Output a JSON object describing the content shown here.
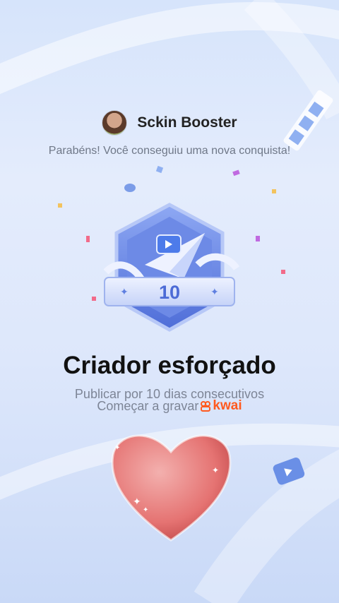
{
  "header": {
    "username": "Sckin Booster"
  },
  "congrats_message": "Parabéns! Você conseguiu uma nova conquista!",
  "badge": {
    "level": "10"
  },
  "achievement": {
    "title": "Criador esforçado",
    "description": "Publicar por 10 dias consecutivos"
  },
  "record": {
    "label": "Começar a gravar",
    "brand": "kwai"
  },
  "colors": {
    "accent": "#ff5a1f",
    "badge_blue": "#5f7fe0",
    "heart": "#e57372"
  }
}
